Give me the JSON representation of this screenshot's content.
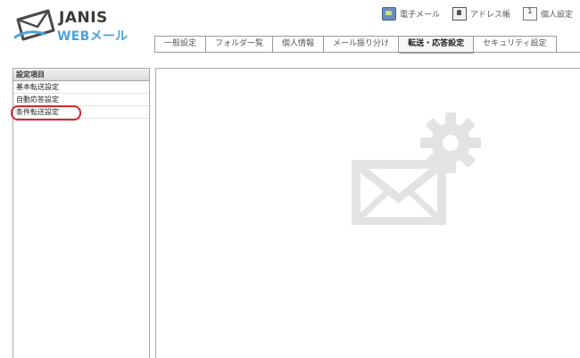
{
  "logo": {
    "line1": "JANIS",
    "line2": "WEBメール"
  },
  "header_links": [
    {
      "label": "電子メール",
      "icon": "mail-icon"
    },
    {
      "label": "アドレス帳",
      "icon": "address-book-icon"
    },
    {
      "label": "個人設定",
      "icon": "personal-settings-icon"
    }
  ],
  "tabs": [
    {
      "label": "一般設定"
    },
    {
      "label": "フォルダ一覧"
    },
    {
      "label": "個人情報"
    },
    {
      "label": "メール振り分け"
    },
    {
      "label": "転送・応答設定",
      "active": true
    },
    {
      "label": "セキュリティ設定"
    }
  ],
  "sidebar": {
    "header": "設定項目",
    "items": [
      {
        "label": "基本転送設定"
      },
      {
        "label": "自動応答設定"
      },
      {
        "label": "条件転送設定",
        "selected": true
      }
    ]
  },
  "colors": {
    "accent": "#4aa3d8",
    "highlight": "#d9262c",
    "placeholder_icon": "#e3e3e3"
  }
}
